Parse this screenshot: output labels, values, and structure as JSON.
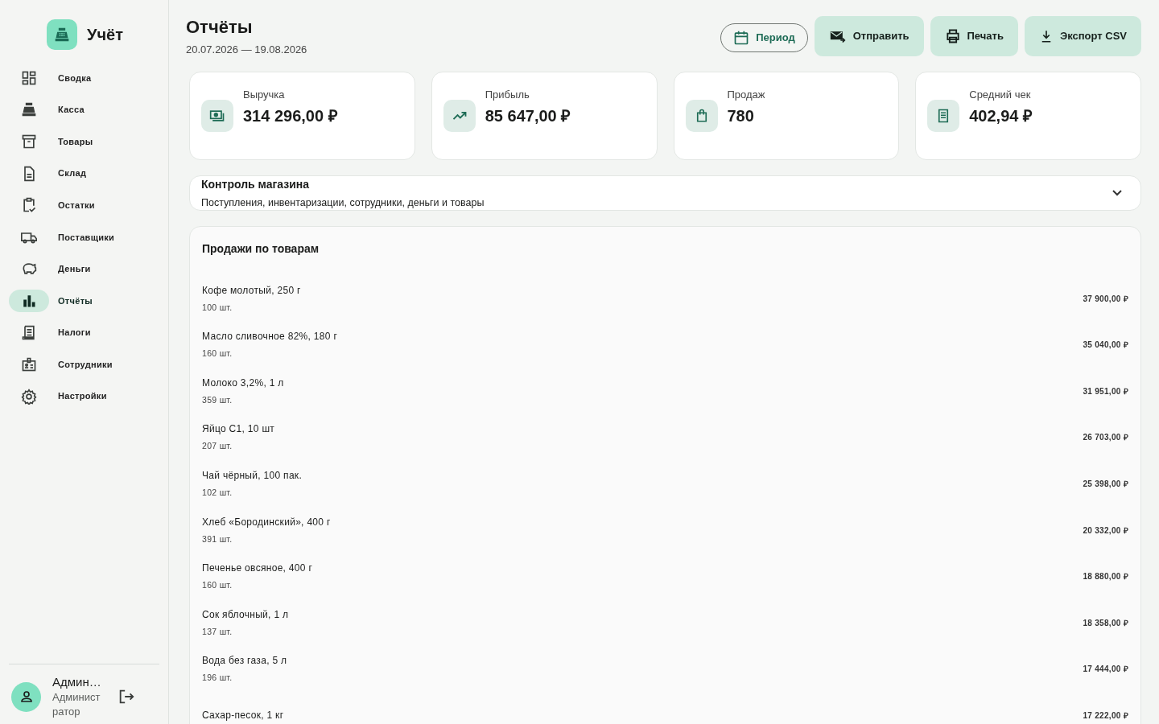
{
  "app": {
    "title": "Учёт"
  },
  "nav": [
    {
      "label": "Сводка",
      "selected": false
    },
    {
      "label": "Касса",
      "selected": false
    },
    {
      "label": "Товары",
      "selected": false
    },
    {
      "label": "Склад",
      "selected": false
    },
    {
      "label": "Остатки",
      "selected": false
    },
    {
      "label": "Поставщики",
      "selected": false
    },
    {
      "label": "Деньги",
      "selected": false
    },
    {
      "label": "Отчёты",
      "selected": true
    },
    {
      "label": "Налоги",
      "selected": false
    },
    {
      "label": "Сотрудники",
      "selected": false
    },
    {
      "label": "Настройки",
      "selected": false
    }
  ],
  "user": {
    "name": "Админ…",
    "role": "Администратор"
  },
  "header": {
    "title": "Отчёты",
    "period": "20.07.2026 — 19.08.2026"
  },
  "actions": [
    {
      "label": "Период",
      "kind": "outline"
    },
    {
      "label": "Отправить",
      "kind": "tonal"
    },
    {
      "label": "Печать",
      "kind": "tonal"
    },
    {
      "label": "Экспорт CSV",
      "kind": "tonal"
    }
  ],
  "stats": [
    {
      "label": "Выручка",
      "value": "314 296,00 ₽"
    },
    {
      "label": "Прибыль",
      "value": "85 647,00 ₽"
    },
    {
      "label": "Продаж",
      "value": "780"
    },
    {
      "label": "Средний чек",
      "value": "402,94 ₽"
    }
  ],
  "control_panel": {
    "title": "Контроль магазина",
    "subtitle": "Поступления, инвентаризации, сотрудники, деньги и товары",
    "expanded": false
  },
  "sales": {
    "title": "Продажи по товарам",
    "rows": [
      {
        "name": "Кофе молотый, 250 г",
        "qty": "100 шт.",
        "amount": "37 900,00 ₽"
      },
      {
        "name": "Масло сливочное 82%, 180 г",
        "qty": "160 шт.",
        "amount": "35 040,00 ₽"
      },
      {
        "name": "Молоко 3,2%, 1 л",
        "qty": "359 шт.",
        "amount": "31 951,00 ₽"
      },
      {
        "name": "Яйцо С1, 10 шт",
        "qty": "207 шт.",
        "amount": "26 703,00 ₽"
      },
      {
        "name": "Чай чёрный, 100 пак.",
        "qty": "102 шт.",
        "amount": "25 398,00 ₽"
      },
      {
        "name": "Хлеб «Бородинский», 400 г",
        "qty": "391 шт.",
        "amount": "20 332,00 ₽"
      },
      {
        "name": "Печенье овсяное, 400 г",
        "qty": "160 шт.",
        "amount": "18 880,00 ₽"
      },
      {
        "name": "Сок яблочный, 1 л",
        "qty": "137 шт.",
        "amount": "18 358,00 ₽"
      },
      {
        "name": "Вода без газа, 5 л",
        "qty": "196 шт.",
        "amount": "17 444,00 ₽"
      },
      {
        "name": "Сахар-песок, 1 кг",
        "amount": "17 222,00 ₽"
      }
    ]
  }
}
